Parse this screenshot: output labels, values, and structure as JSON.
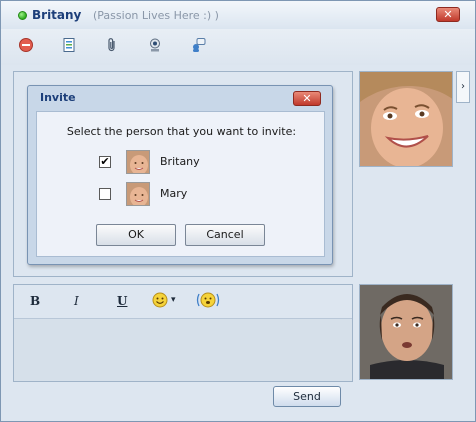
{
  "titlebar": {
    "name": "Britany",
    "status_message": "(Passion Lives Here :) )",
    "close_label": "✕"
  },
  "toolbar": {
    "icons": [
      "block-icon",
      "contact-card-icon",
      "paperclip-icon",
      "webcam-icon",
      "invite-icon"
    ]
  },
  "format_bar": {
    "bold": "B",
    "italic": "I",
    "underline": "U",
    "emoticon_dropdown": "▾"
  },
  "send_button": {
    "label": "Send"
  },
  "side_toggle": {
    "label": "›"
  },
  "invite_dialog": {
    "title": "Invite",
    "close_label": "✕",
    "prompt": "Select the person that you want to invite:",
    "people": [
      {
        "name": "Britany",
        "checked": true,
        "check_mark": "✔"
      },
      {
        "name": "Mary",
        "checked": false,
        "check_mark": ""
      }
    ],
    "ok_label": "OK",
    "cancel_label": "Cancel"
  },
  "colors": {
    "accent": "#1d3f7a",
    "window_bg": "#dde6f0",
    "dialog_bg": "#eef2f9",
    "online": "#2fae1f",
    "close_red": "#c0392b"
  }
}
